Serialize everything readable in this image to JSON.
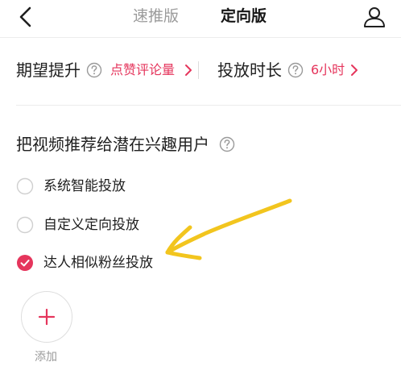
{
  "header": {
    "tabs": [
      {
        "label": "速推版"
      },
      {
        "label": "定向版"
      }
    ],
    "active_tab": "定向版"
  },
  "settings": {
    "goal_label": "期望提升",
    "goal_value": "点赞评论量",
    "duration_label": "投放时长",
    "duration_value": "6小时"
  },
  "audience": {
    "title": "把视频推荐给潜在兴趣用户",
    "options": [
      {
        "label": "系统智能投放",
        "selected": false
      },
      {
        "label": "自定义定向投放",
        "selected": false
      },
      {
        "label": "达人相似粉丝投放",
        "selected": true
      }
    ],
    "add_label": "添加"
  },
  "colors": {
    "accent": "#e5355c",
    "annotation": "#f2c51e",
    "muted": "#9a9a9a"
  },
  "icons": [
    "back-icon",
    "profile-icon",
    "help-icon",
    "chevron-right-icon",
    "plus-icon"
  ]
}
